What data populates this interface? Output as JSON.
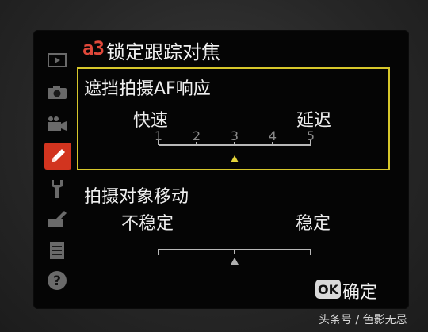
{
  "header": {
    "menu_code": "a3",
    "title": "锁定跟踪对焦"
  },
  "sidebar": {
    "items": [
      {
        "icon": "playback-icon",
        "active": false
      },
      {
        "icon": "camera-icon",
        "active": false
      },
      {
        "icon": "movie-camera-icon",
        "active": false
      },
      {
        "icon": "pencil-icon",
        "active": true
      },
      {
        "icon": "wrench-icon",
        "active": false
      },
      {
        "icon": "retouch-icon",
        "active": false
      },
      {
        "icon": "my-menu-icon",
        "active": false
      },
      {
        "icon": "help-icon",
        "active": false
      }
    ]
  },
  "options": [
    {
      "title": "遮挡拍摄AF响应",
      "left_label": "快速",
      "right_label": "延迟",
      "ticks": [
        "1",
        "2",
        "3",
        "4",
        "5"
      ],
      "value": 3,
      "selected": true
    },
    {
      "title": "拍摄对象移动",
      "left_label": "不稳定",
      "right_label": "稳定",
      "value": 3,
      "selected": false
    }
  ],
  "footer": {
    "ok_badge": "OK",
    "ok_label": "确定"
  },
  "watermark": "头条号 / 色影无忌",
  "colors": {
    "accent_yellow": "#d7c72b",
    "accent_red": "#d2341f",
    "text": "#f0f0f0"
  }
}
